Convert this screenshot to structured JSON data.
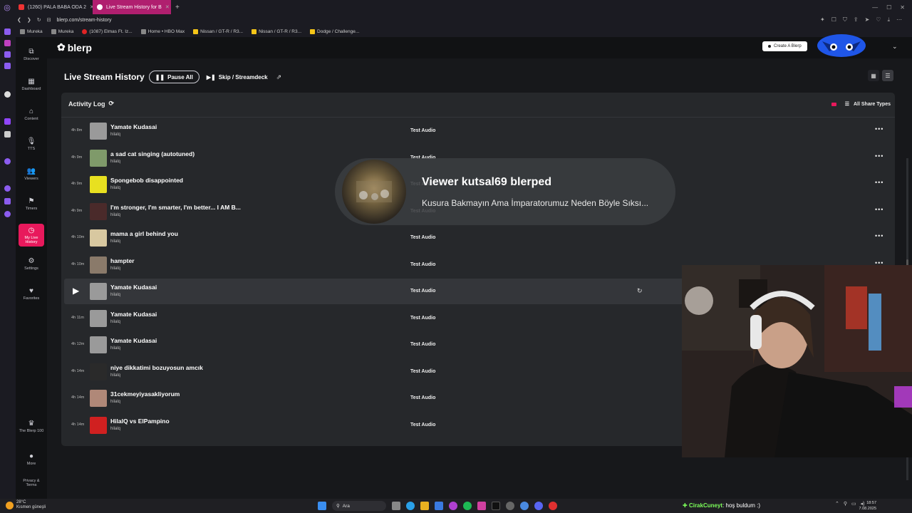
{
  "browser": {
    "tabs": [
      {
        "label": "(1260) PALA BABA ODA 2",
        "active": false
      },
      {
        "label": "Live Stream History for B",
        "active": true
      }
    ],
    "url": "blerp.com/stream-history",
    "bookmarks": [
      "Mureka",
      "Mureka",
      "(1087) Elmas Ft. Iz...",
      "Home • HBO Max",
      "Nissan / GT-R / R3...",
      "Nissan / GT-R / R3...",
      "Dodge / Challenge..."
    ]
  },
  "app": {
    "logo": "blerp",
    "create_label": "Create A Blerp",
    "nav": [
      {
        "label": "Discover",
        "icon": "discover-icon",
        "glyph": "⧉"
      },
      {
        "label": "Dashboard",
        "icon": "dashboard-icon",
        "glyph": "▦"
      },
      {
        "label": "Content",
        "icon": "content-icon",
        "glyph": "⌂"
      },
      {
        "label": "TTS",
        "icon": "microphone-icon",
        "glyph": "🎙"
      },
      {
        "label": "Viewers",
        "icon": "viewers-icon",
        "glyph": "👥"
      },
      {
        "label": "Timers",
        "icon": "flag-icon",
        "glyph": "⚑"
      },
      {
        "label": "My Live History",
        "icon": "history-icon",
        "glyph": "◷"
      },
      {
        "label": "Settings",
        "icon": "gear-icon",
        "glyph": "⚙"
      },
      {
        "label": "Favorites",
        "icon": "heart-icon",
        "glyph": "♥"
      }
    ],
    "nav_bottom": [
      {
        "label": "The Blerp 100",
        "icon": "trophy-icon",
        "glyph": "♛"
      },
      {
        "label": "More",
        "icon": "more-icon",
        "glyph": "●"
      },
      {
        "label": "Privacy & Terms",
        "icon": "",
        "glyph": ""
      }
    ]
  },
  "header": {
    "title": "Live Stream History",
    "pause_label": "Pause All",
    "skip_label": "Skip / Streamdeck"
  },
  "panel": {
    "title": "Activity Log",
    "filter_label": "All Share Types"
  },
  "rows": [
    {
      "time": "4h 8m",
      "title": "Yamate Kudasai",
      "user": "hilalq",
      "type": "Test Audio",
      "thumb": "#9a9a9a"
    },
    {
      "time": "4h 9m",
      "title": "a sad cat singing (autotuned)",
      "user": "hilalq",
      "type": "Test Audio",
      "thumb": "#7f9a6a"
    },
    {
      "time": "4h 9m",
      "title": "Spongebob disappointed",
      "user": "hilalq",
      "type": "Test Audio",
      "thumb": "#e8e020"
    },
    {
      "time": "4h 9m",
      "title": "I'm stronger, I'm smarter, I'm better... I AM B...",
      "user": "hilalq",
      "type": "Test Audio",
      "thumb": "#4a2a2a"
    },
    {
      "time": "4h 10m",
      "title": "mama a girl behind you",
      "user": "hilalq",
      "type": "Test Audio",
      "thumb": "#d8c8a0"
    },
    {
      "time": "4h 10m",
      "title": "hampter",
      "user": "hilalq",
      "type": "Test Audio",
      "thumb": "#8a7a6a"
    },
    {
      "time": "",
      "title": "Yamate Kudasai",
      "user": "hilalq",
      "type": "Test Audio",
      "thumb": "#9a9a9a",
      "highlight": true
    },
    {
      "time": "4h 11m",
      "title": "Yamate Kudasai",
      "user": "hilalq",
      "type": "Test Audio",
      "thumb": "#9a9a9a"
    },
    {
      "time": "4h 12m",
      "title": "Yamate Kudasai",
      "user": "hilalq",
      "type": "Test Audio",
      "thumb": "#9a9a9a"
    },
    {
      "time": "4h 14m",
      "title": "niye dikkatimi bozuyosun amcık",
      "user": "hilalq",
      "type": "Test Audio",
      "thumb": "#2a2a2a"
    },
    {
      "time": "4h 14m",
      "title": "31cekmeyiyasakliyorum",
      "user": "hilalq",
      "type": "Test Audio",
      "thumb": "#b08878"
    },
    {
      "time": "4h 14m",
      "title": "HilalQ vs ElPampino",
      "user": "hilalq",
      "type": "Test Audio",
      "thumb": "#d02020"
    }
  ],
  "toast": {
    "title": "Viewer kutsal69 blerped",
    "subtitle": "Kusura Bakmayın Ama İmparatorumuz Neden Böyle Sıksı..."
  },
  "taskbar": {
    "weather_temp": "28°C",
    "weather_desc": "Kısmen güneşli",
    "search_placeholder": "Ara",
    "chat_user": "CirakCuneyt",
    "chat_msg": ": hoş buldum :)",
    "time": "18:57",
    "date": "7.08.2025"
  },
  "colors": {
    "accent": "#e8195c",
    "background": "#17181b",
    "panel": "#26282b"
  }
}
